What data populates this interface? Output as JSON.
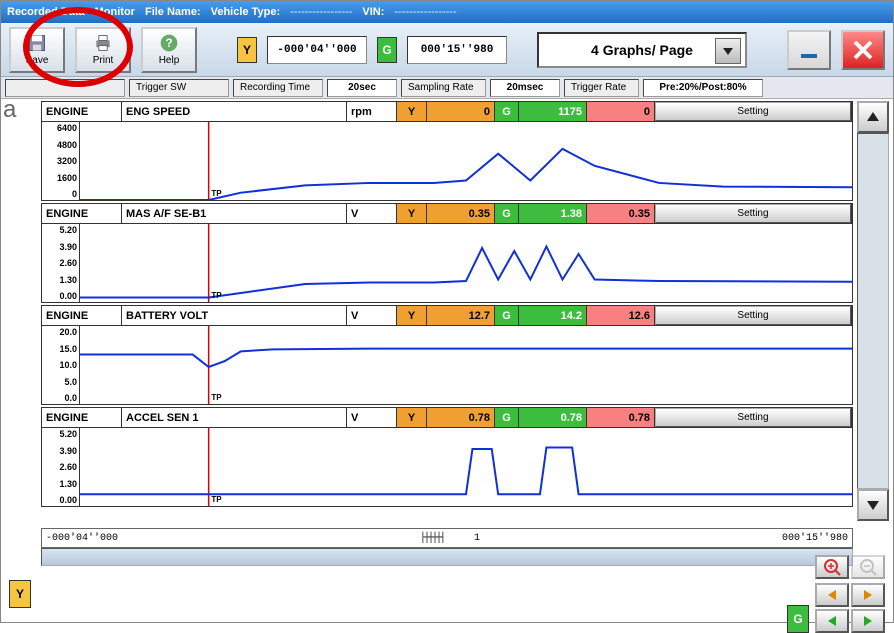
{
  "titlebar": {
    "app_title": "Recorded Data",
    "monitor_label": "Monitor",
    "filename_label": "File Name:",
    "vehicle_type_label": "Vehicle Type:",
    "vehicle_type_value": "-----------------",
    "vin_label": "VIN:",
    "vin_value": "-----------------"
  },
  "toolbar": {
    "save_label": "Save",
    "print_label": "Print",
    "help_label": "Help",
    "y_marker": "Y",
    "y_time": "-000'04''000",
    "g_marker": "G",
    "g_time": "000'15''980",
    "dropdown_label": "4 Graphs/ Page"
  },
  "infobar": {
    "trigger_sw_label": "Trigger SW",
    "recording_time_label": "Recording Time",
    "recording_time_value": "20sec",
    "sampling_rate_label": "Sampling Rate",
    "sampling_rate_value": "20msec",
    "trigger_rate_label": "Trigger Rate",
    "trigger_rate_value": "Pre:20%/Post:80%"
  },
  "graphs": [
    {
      "system": "ENGINE",
      "signal": "ENG SPEED",
      "unit": "rpm",
      "y_val": "0",
      "g_val": "1175",
      "r_val": "0",
      "ticks": [
        "6400",
        "4800",
        "3200",
        "1600",
        "0"
      ],
      "setting": "Setting"
    },
    {
      "system": "ENGINE",
      "signal": "MAS A/F SE-B1",
      "unit": "V",
      "y_val": "0.35",
      "g_val": "1.38",
      "r_val": "0.35",
      "ticks": [
        "5.20",
        "3.90",
        "2.60",
        "1.30",
        "0.00"
      ],
      "setting": "Setting"
    },
    {
      "system": "ENGINE",
      "signal": "BATTERY VOLT",
      "unit": "V",
      "y_val": "12.7",
      "g_val": "14.2",
      "r_val": "12.6",
      "ticks": [
        "20.0",
        "15.0",
        "10.0",
        "5.0",
        "0.0"
      ],
      "setting": "Setting"
    },
    {
      "system": "ENGINE",
      "signal": "ACCEL SEN 1",
      "unit": "V",
      "y_val": "0.78",
      "g_val": "0.78",
      "r_val": "0.78",
      "ticks": [
        "5.20",
        "3.90",
        "2.60",
        "1.30",
        "0.00"
      ],
      "setting": "Setting"
    }
  ],
  "labels": {
    "y": "Y",
    "g": "G",
    "tp": "TP",
    "tick_1": "1"
  },
  "timeline": {
    "start": "-000'04''000",
    "end": "000'15''980"
  },
  "chart_data": [
    {
      "type": "line",
      "signal": "ENG SPEED",
      "unit": "rpm",
      "ylim": [
        0,
        6400
      ],
      "x_seconds": [
        -4,
        20
      ],
      "points": [
        [
          -4,
          0
        ],
        [
          0,
          0
        ],
        [
          1,
          600
        ],
        [
          3,
          1200
        ],
        [
          5,
          1400
        ],
        [
          7,
          1400
        ],
        [
          8,
          1600
        ],
        [
          9,
          3800
        ],
        [
          10,
          1600
        ],
        [
          11,
          4200
        ],
        [
          12,
          2800
        ],
        [
          14,
          1400
        ],
        [
          16,
          1100
        ],
        [
          20,
          1050
        ]
      ]
    },
    {
      "type": "line",
      "signal": "MAS A/F SE-B1",
      "unit": "V",
      "ylim": [
        0,
        5.2
      ],
      "x_seconds": [
        -4,
        20
      ],
      "points": [
        [
          -4,
          0.3
        ],
        [
          0,
          0.3
        ],
        [
          1,
          0.6
        ],
        [
          3,
          1.2
        ],
        [
          5,
          1.3
        ],
        [
          7,
          1.3
        ],
        [
          8,
          1.4
        ],
        [
          8.5,
          3.6
        ],
        [
          9,
          1.5
        ],
        [
          9.5,
          3.4
        ],
        [
          10,
          1.5
        ],
        [
          10.5,
          3.7
        ],
        [
          11,
          1.5
        ],
        [
          11.5,
          3.2
        ],
        [
          12,
          1.5
        ],
        [
          14,
          1.4
        ],
        [
          20,
          1.35
        ]
      ]
    },
    {
      "type": "line",
      "signal": "BATTERY VOLT",
      "unit": "V",
      "ylim": [
        0,
        20
      ],
      "x_seconds": [
        -4,
        20
      ],
      "points": [
        [
          -4,
          12.7
        ],
        [
          -0.5,
          12.7
        ],
        [
          0,
          9.5
        ],
        [
          0.5,
          11
        ],
        [
          1,
          13.5
        ],
        [
          2,
          14
        ],
        [
          5,
          14.2
        ],
        [
          20,
          14.2
        ]
      ]
    },
    {
      "type": "line",
      "signal": "ACCEL SEN 1",
      "unit": "V",
      "ylim": [
        0,
        5.2
      ],
      "x_seconds": [
        -4,
        20
      ],
      "points": [
        [
          -4,
          0.78
        ],
        [
          8,
          0.78
        ],
        [
          8.2,
          3.8
        ],
        [
          8.8,
          3.8
        ],
        [
          9,
          0.78
        ],
        [
          10.3,
          0.78
        ],
        [
          10.5,
          3.9
        ],
        [
          11.3,
          3.9
        ],
        [
          11.5,
          0.78
        ],
        [
          20,
          0.78
        ]
      ]
    }
  ]
}
